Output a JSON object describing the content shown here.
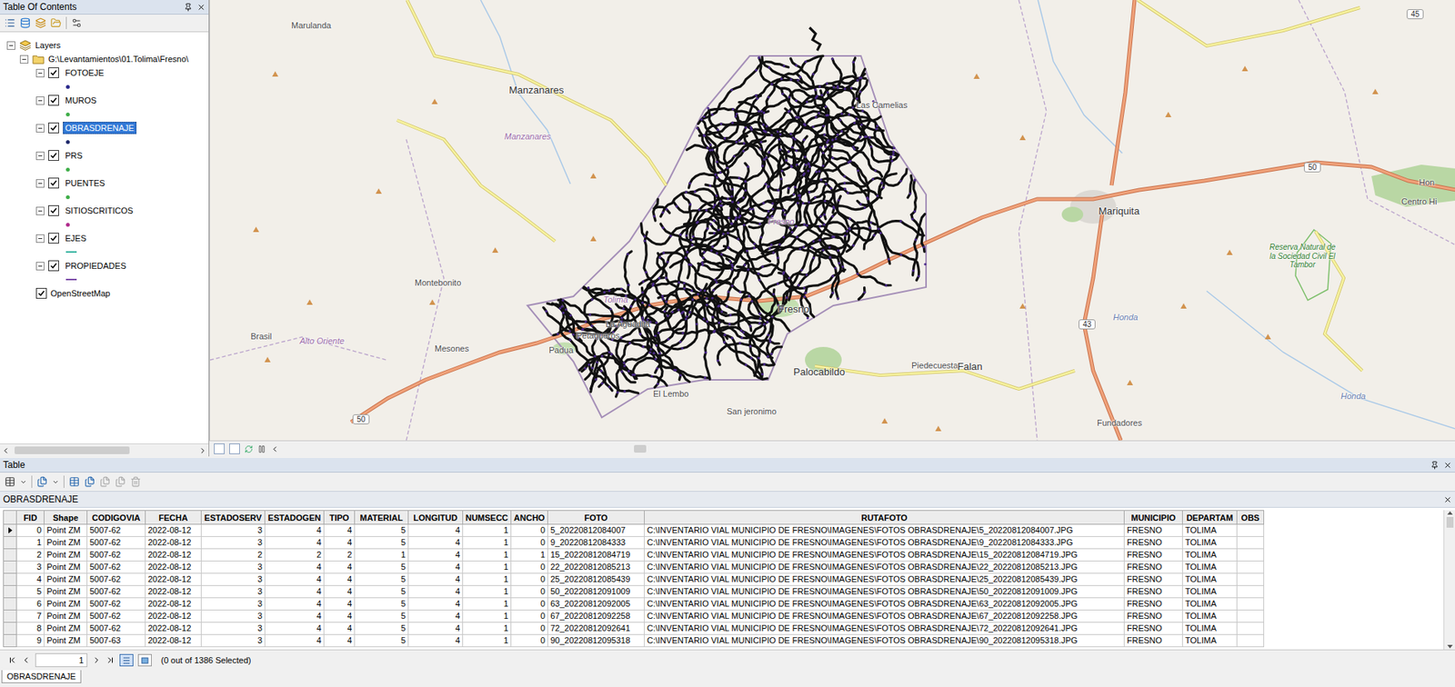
{
  "toc": {
    "title": "Table Of Contents",
    "root": {
      "label": "Layers",
      "expanded": true
    },
    "folder": {
      "label": "G:\\Levantamientos\\01.Tolima\\Fresno\\",
      "expanded": true
    },
    "layers": [
      {
        "name": "FOTOEJE",
        "checked": true,
        "expanded": true,
        "selected": false,
        "kind": "point",
        "color": "#2b2a8c"
      },
      {
        "name": "MUROS",
        "checked": true,
        "expanded": true,
        "selected": false,
        "kind": "point",
        "color": "#3fae49"
      },
      {
        "name": "OBRASDRENAJE",
        "checked": true,
        "expanded": true,
        "selected": true,
        "kind": "point",
        "color": "#1f2a6b"
      },
      {
        "name": "PRS",
        "checked": true,
        "expanded": true,
        "selected": false,
        "kind": "point",
        "color": "#3fae49"
      },
      {
        "name": "PUENTES",
        "checked": true,
        "expanded": true,
        "selected": false,
        "kind": "point",
        "color": "#3fae49"
      },
      {
        "name": "SITIOSCRITICOS",
        "checked": true,
        "expanded": true,
        "selected": false,
        "kind": "point",
        "color": "#b02b8c"
      },
      {
        "name": "EJES",
        "checked": true,
        "expanded": true,
        "selected": false,
        "kind": "line",
        "color": "#3cb6a4"
      },
      {
        "name": "PROPIEDADES",
        "checked": true,
        "expanded": true,
        "selected": false,
        "kind": "line",
        "color": "#7b4ba8"
      }
    ],
    "basemap": {
      "name": "OpenStreetMap",
      "checked": true
    }
  },
  "map": {
    "labels": [
      {
        "text": "Marulanda",
        "kind": "village"
      },
      {
        "text": "Manzanares",
        "kind": "town"
      },
      {
        "text": "Manzanares",
        "kind": "admin"
      },
      {
        "text": "Las Camelias",
        "kind": "village"
      },
      {
        "text": "Mariquita",
        "kind": "town"
      },
      {
        "text": "Fresno",
        "kind": "admin"
      },
      {
        "text": "Fresno",
        "kind": "town"
      },
      {
        "text": "Montebonito",
        "kind": "village"
      },
      {
        "text": "Petaqueros",
        "kind": "village"
      },
      {
        "text": "La Aguadita",
        "kind": "village"
      },
      {
        "text": "Padua",
        "kind": "village"
      },
      {
        "text": "Brasil",
        "kind": "village"
      },
      {
        "text": "Mesones",
        "kind": "village"
      },
      {
        "text": "Alto Oriente",
        "kind": "admin"
      },
      {
        "text": "El Lembo",
        "kind": "village"
      },
      {
        "text": "San jeronimo",
        "kind": "village"
      },
      {
        "text": "Palocabildo",
        "kind": "town"
      },
      {
        "text": "Piedecuesta",
        "kind": "village"
      },
      {
        "text": "Falan",
        "kind": "town"
      },
      {
        "text": "Fundadores",
        "kind": "village"
      },
      {
        "text": "Reserva Natural de la Sociedad Civil El Tambor",
        "kind": "park"
      },
      {
        "text": "Centro Hi",
        "kind": "village"
      },
      {
        "text": "Hon",
        "kind": "village"
      },
      {
        "text": "Tolima",
        "kind": "admin"
      },
      {
        "text": "Honda",
        "kind": "water"
      },
      {
        "text": "Honda",
        "kind": "water"
      }
    ],
    "shields": [
      "45",
      "50",
      "50",
      "43"
    ]
  },
  "table": {
    "title": "Table",
    "layer": "OBRASDRENAJE",
    "columns": [
      "FID",
      "Shape",
      "CODIGOVIA",
      "FECHA",
      "ESTADOSERV",
      "ESTADOGEN",
      "TIPO",
      "MATERIAL",
      "LONGITUD",
      "NUMSECC",
      "ANCHO",
      "FOTO",
      "RUTAFOTO",
      "MUNICIPIO",
      "DEPARTAM",
      "OBS"
    ],
    "rows": [
      {
        "current": true,
        "cells": [
          "0",
          "Point ZM",
          "5007-62",
          "2022-08-12",
          "3",
          "4",
          "4",
          "5",
          "4",
          "1",
          "0",
          "5_20220812084007",
          "C:\\INVENTARIO VIAL MUNICIPIO DE FRESNO\\IMAGENES\\FOTOS OBRASDRENAJE\\5_20220812084007.JPG",
          "FRESNO",
          "TOLIMA",
          ""
        ]
      },
      {
        "current": false,
        "cells": [
          "1",
          "Point ZM",
          "5007-62",
          "2022-08-12",
          "3",
          "4",
          "4",
          "5",
          "4",
          "1",
          "0",
          "9_20220812084333",
          "C:\\INVENTARIO VIAL MUNICIPIO DE FRESNO\\IMAGENES\\FOTOS OBRASDRENAJE\\9_20220812084333.JPG",
          "FRESNO",
          "TOLIMA",
          ""
        ]
      },
      {
        "current": false,
        "cells": [
          "2",
          "Point ZM",
          "5007-62",
          "2022-08-12",
          "2",
          "2",
          "2",
          "1",
          "4",
          "1",
          "1",
          "15_20220812084719",
          "C:\\INVENTARIO VIAL MUNICIPIO DE FRESNO\\IMAGENES\\FOTOS OBRASDRENAJE\\15_20220812084719.JPG",
          "FRESNO",
          "TOLIMA",
          ""
        ]
      },
      {
        "current": false,
        "cells": [
          "3",
          "Point ZM",
          "5007-62",
          "2022-08-12",
          "3",
          "4",
          "4",
          "5",
          "4",
          "1",
          "0",
          "22_20220812085213",
          "C:\\INVENTARIO VIAL MUNICIPIO DE FRESNO\\IMAGENES\\FOTOS OBRASDRENAJE\\22_20220812085213.JPG",
          "FRESNO",
          "TOLIMA",
          ""
        ]
      },
      {
        "current": false,
        "cells": [
          "4",
          "Point ZM",
          "5007-62",
          "2022-08-12",
          "3",
          "4",
          "4",
          "5",
          "4",
          "1",
          "0",
          "25_20220812085439",
          "C:\\INVENTARIO VIAL MUNICIPIO DE FRESNO\\IMAGENES\\FOTOS OBRASDRENAJE\\25_20220812085439.JPG",
          "FRESNO",
          "TOLIMA",
          ""
        ]
      },
      {
        "current": false,
        "cells": [
          "5",
          "Point ZM",
          "5007-62",
          "2022-08-12",
          "3",
          "4",
          "4",
          "5",
          "4",
          "1",
          "0",
          "50_20220812091009",
          "C:\\INVENTARIO VIAL MUNICIPIO DE FRESNO\\IMAGENES\\FOTOS OBRASDRENAJE\\50_20220812091009.JPG",
          "FRESNO",
          "TOLIMA",
          ""
        ]
      },
      {
        "current": false,
        "cells": [
          "6",
          "Point ZM",
          "5007-62",
          "2022-08-12",
          "3",
          "4",
          "4",
          "5",
          "4",
          "1",
          "0",
          "63_20220812092005",
          "C:\\INVENTARIO VIAL MUNICIPIO DE FRESNO\\IMAGENES\\FOTOS OBRASDRENAJE\\63_20220812092005.JPG",
          "FRESNO",
          "TOLIMA",
          ""
        ]
      },
      {
        "current": false,
        "cells": [
          "7",
          "Point ZM",
          "5007-62",
          "2022-08-12",
          "3",
          "4",
          "4",
          "5",
          "4",
          "1",
          "0",
          "67_20220812092258",
          "C:\\INVENTARIO VIAL MUNICIPIO DE FRESNO\\IMAGENES\\FOTOS OBRASDRENAJE\\67_20220812092258.JPG",
          "FRESNO",
          "TOLIMA",
          ""
        ]
      },
      {
        "current": false,
        "cells": [
          "8",
          "Point ZM",
          "5007-62",
          "2022-08-12",
          "3",
          "4",
          "4",
          "5",
          "4",
          "1",
          "0",
          "72_20220812092641",
          "C:\\INVENTARIO VIAL MUNICIPIO DE FRESNO\\IMAGENES\\FOTOS OBRASDRENAJE\\72_20220812092641.JPG",
          "FRESNO",
          "TOLIMA",
          ""
        ]
      },
      {
        "current": false,
        "cells": [
          "9",
          "Point ZM",
          "5007-63",
          "2022-08-12",
          "3",
          "4",
          "4",
          "5",
          "4",
          "1",
          "0",
          "90_20220812095318",
          "C:\\INVENTARIO VIAL MUNICIPIO DE FRESNO\\IMAGENES\\FOTOS OBRASDRENAJE\\90_20220812095318.JPG",
          "FRESNO",
          "TOLIMA",
          ""
        ]
      }
    ],
    "page": "1",
    "selection": "(0 out of 1386 Selected)"
  },
  "tabs": [
    {
      "label": "OBRASDRENAJE",
      "selected": true
    }
  ]
}
